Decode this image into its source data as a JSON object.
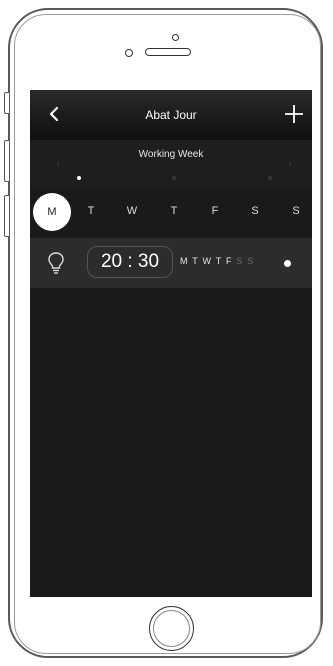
{
  "header": {
    "title": "Abat Jour",
    "back_icon": "chevron-left-icon",
    "add_icon": "plus-icon"
  },
  "program": {
    "name": "Working Week",
    "page_count": 3,
    "active_page": 0
  },
  "days": [
    {
      "label": "M",
      "selected": true
    },
    {
      "label": "T",
      "selected": false
    },
    {
      "label": "W",
      "selected": false
    },
    {
      "label": "T",
      "selected": false
    },
    {
      "label": "F",
      "selected": false
    },
    {
      "label": "S",
      "selected": false
    },
    {
      "label": "S",
      "selected": false
    }
  ],
  "schedule": {
    "icon": "light-bulb-icon",
    "time": "20 : 30",
    "repeat_days": [
      {
        "label": "M",
        "active": true
      },
      {
        "label": "T",
        "active": true
      },
      {
        "label": "W",
        "active": true
      },
      {
        "label": "T",
        "active": true
      },
      {
        "label": "F",
        "active": true
      },
      {
        "label": "S",
        "active": false
      },
      {
        "label": "S",
        "active": false
      }
    ],
    "enabled": true
  },
  "colors": {
    "screen_bg": "#1a1a1a",
    "row_bg": "#2c2c2c",
    "accent": "#ffffff",
    "inactive_text": "#6a6a6a"
  }
}
